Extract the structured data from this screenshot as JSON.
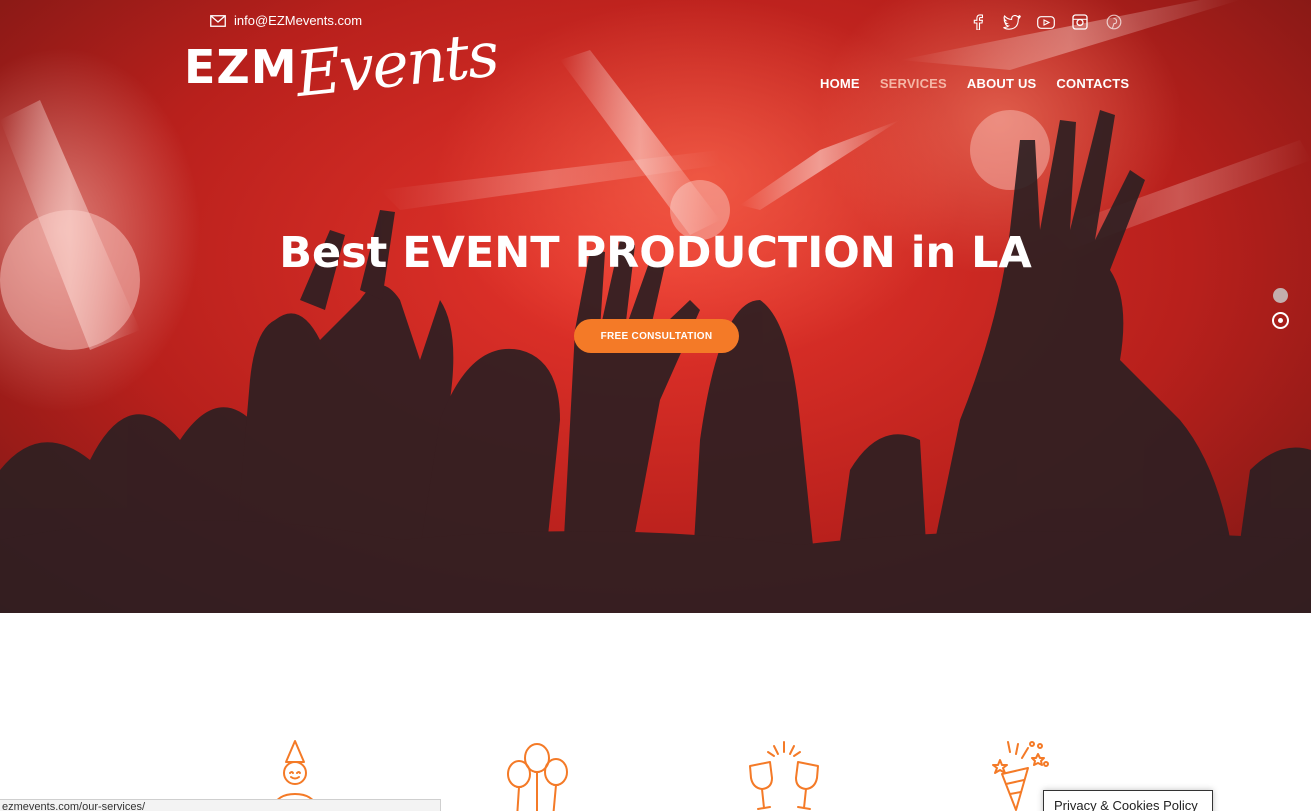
{
  "topbar": {
    "email": "info@EZMevents.com",
    "socials": [
      "facebook-icon",
      "twitter-icon",
      "youtube-icon",
      "instagram-icon",
      "pinterest-icon"
    ]
  },
  "logo": {
    "part1": "EZM",
    "part2": "Events"
  },
  "nav": {
    "items": [
      {
        "label": "HOME"
      },
      {
        "label": "SERVICES"
      },
      {
        "label": "ABOUT US"
      },
      {
        "label": "CONTACTS"
      }
    ],
    "active_index": 1
  },
  "hero": {
    "headline": "Best EVENT PRODUCTION in LA",
    "cta_label": "FREE CONSULTATION",
    "slides_count": 2,
    "active_slide": 2
  },
  "services": {
    "icons": [
      "party-hat-icon",
      "balloons-icon",
      "champagne-toast-icon",
      "party-popper-icon"
    ],
    "accent_color": "#f47a27"
  },
  "status_bar": {
    "url": "ezmevents.com/our-services/"
  },
  "cookie_banner": {
    "label": "Privacy & Cookies Policy"
  },
  "colors": {
    "accent": "#f47a27",
    "hero_red": "#d9302a",
    "nav_active": "#f5b6a6"
  }
}
